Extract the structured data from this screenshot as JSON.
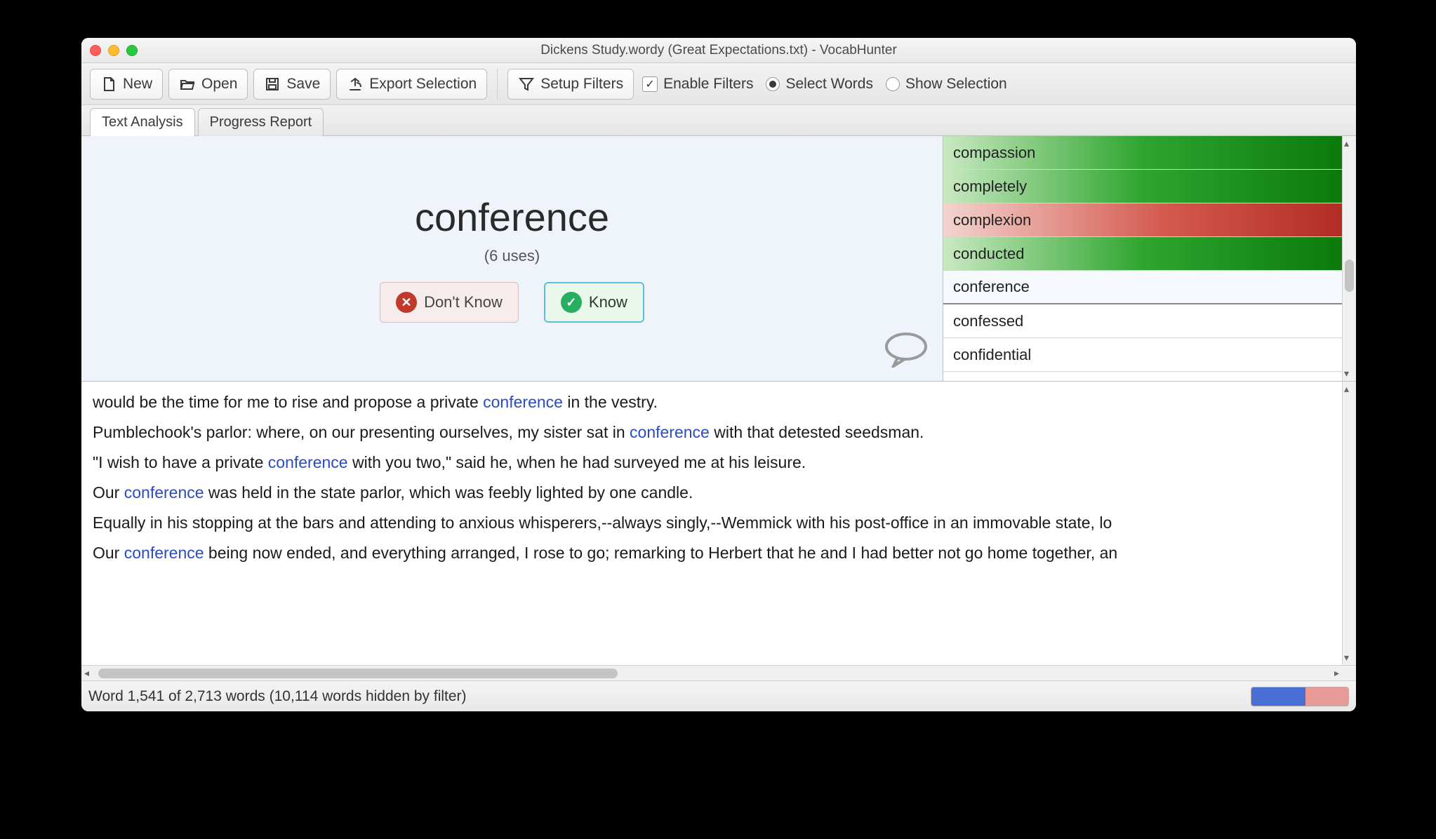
{
  "title": "Dickens Study.wordy (Great Expectations.txt) - VocabHunter",
  "toolbar": {
    "new": "New",
    "open": "Open",
    "save": "Save",
    "export": "Export Selection",
    "setupFilters": "Setup Filters",
    "enableFilters": "Enable Filters",
    "selectWords": "Select Words",
    "showSelection": "Show Selection"
  },
  "tabs": {
    "textAnalysis": "Text Analysis",
    "progressReport": "Progress Report"
  },
  "focus": {
    "word": "conference",
    "uses": "(6 uses)",
    "dontKnow": "Don't Know",
    "know": "Know"
  },
  "wordList": [
    {
      "text": "compassion",
      "state": "green"
    },
    {
      "text": "completely",
      "state": "green"
    },
    {
      "text": "complexion",
      "state": "red"
    },
    {
      "text": "conducted",
      "state": "green"
    },
    {
      "text": "conference",
      "state": "sel"
    },
    {
      "text": "confessed",
      "state": ""
    },
    {
      "text": "confidential",
      "state": ""
    }
  ],
  "usages": [
    {
      "pre": "would be the time for me to rise and propose a private ",
      "w": "conference",
      "post": " in the vestry."
    },
    {
      "pre": "Pumblechook's parlor: where, on our presenting ourselves, my sister sat in ",
      "w": "conference",
      "post": " with that detested seedsman."
    },
    {
      "pre": "\"I wish to have a private ",
      "w": "conference",
      "post": " with you two,\" said he, when he had surveyed me at his leisure."
    },
    {
      "pre": "Our ",
      "w": "conference",
      "post": " was held in the state parlor, which was feebly lighted by one candle."
    },
    {
      "pre": "Equally in his stopping at the bars and attending to anxious whisperers,--always singly,--Wemmick with his post-office in an immovable state, lo",
      "w": "",
      "post": ""
    },
    {
      "pre": "Our ",
      "w": "conference",
      "post": " being now ended, and everything arranged, I rose to go; remarking to Herbert that he and I had better not go home together, an"
    }
  ],
  "status": "Word 1,541 of 2,713 words (10,114 words hidden by filter)"
}
